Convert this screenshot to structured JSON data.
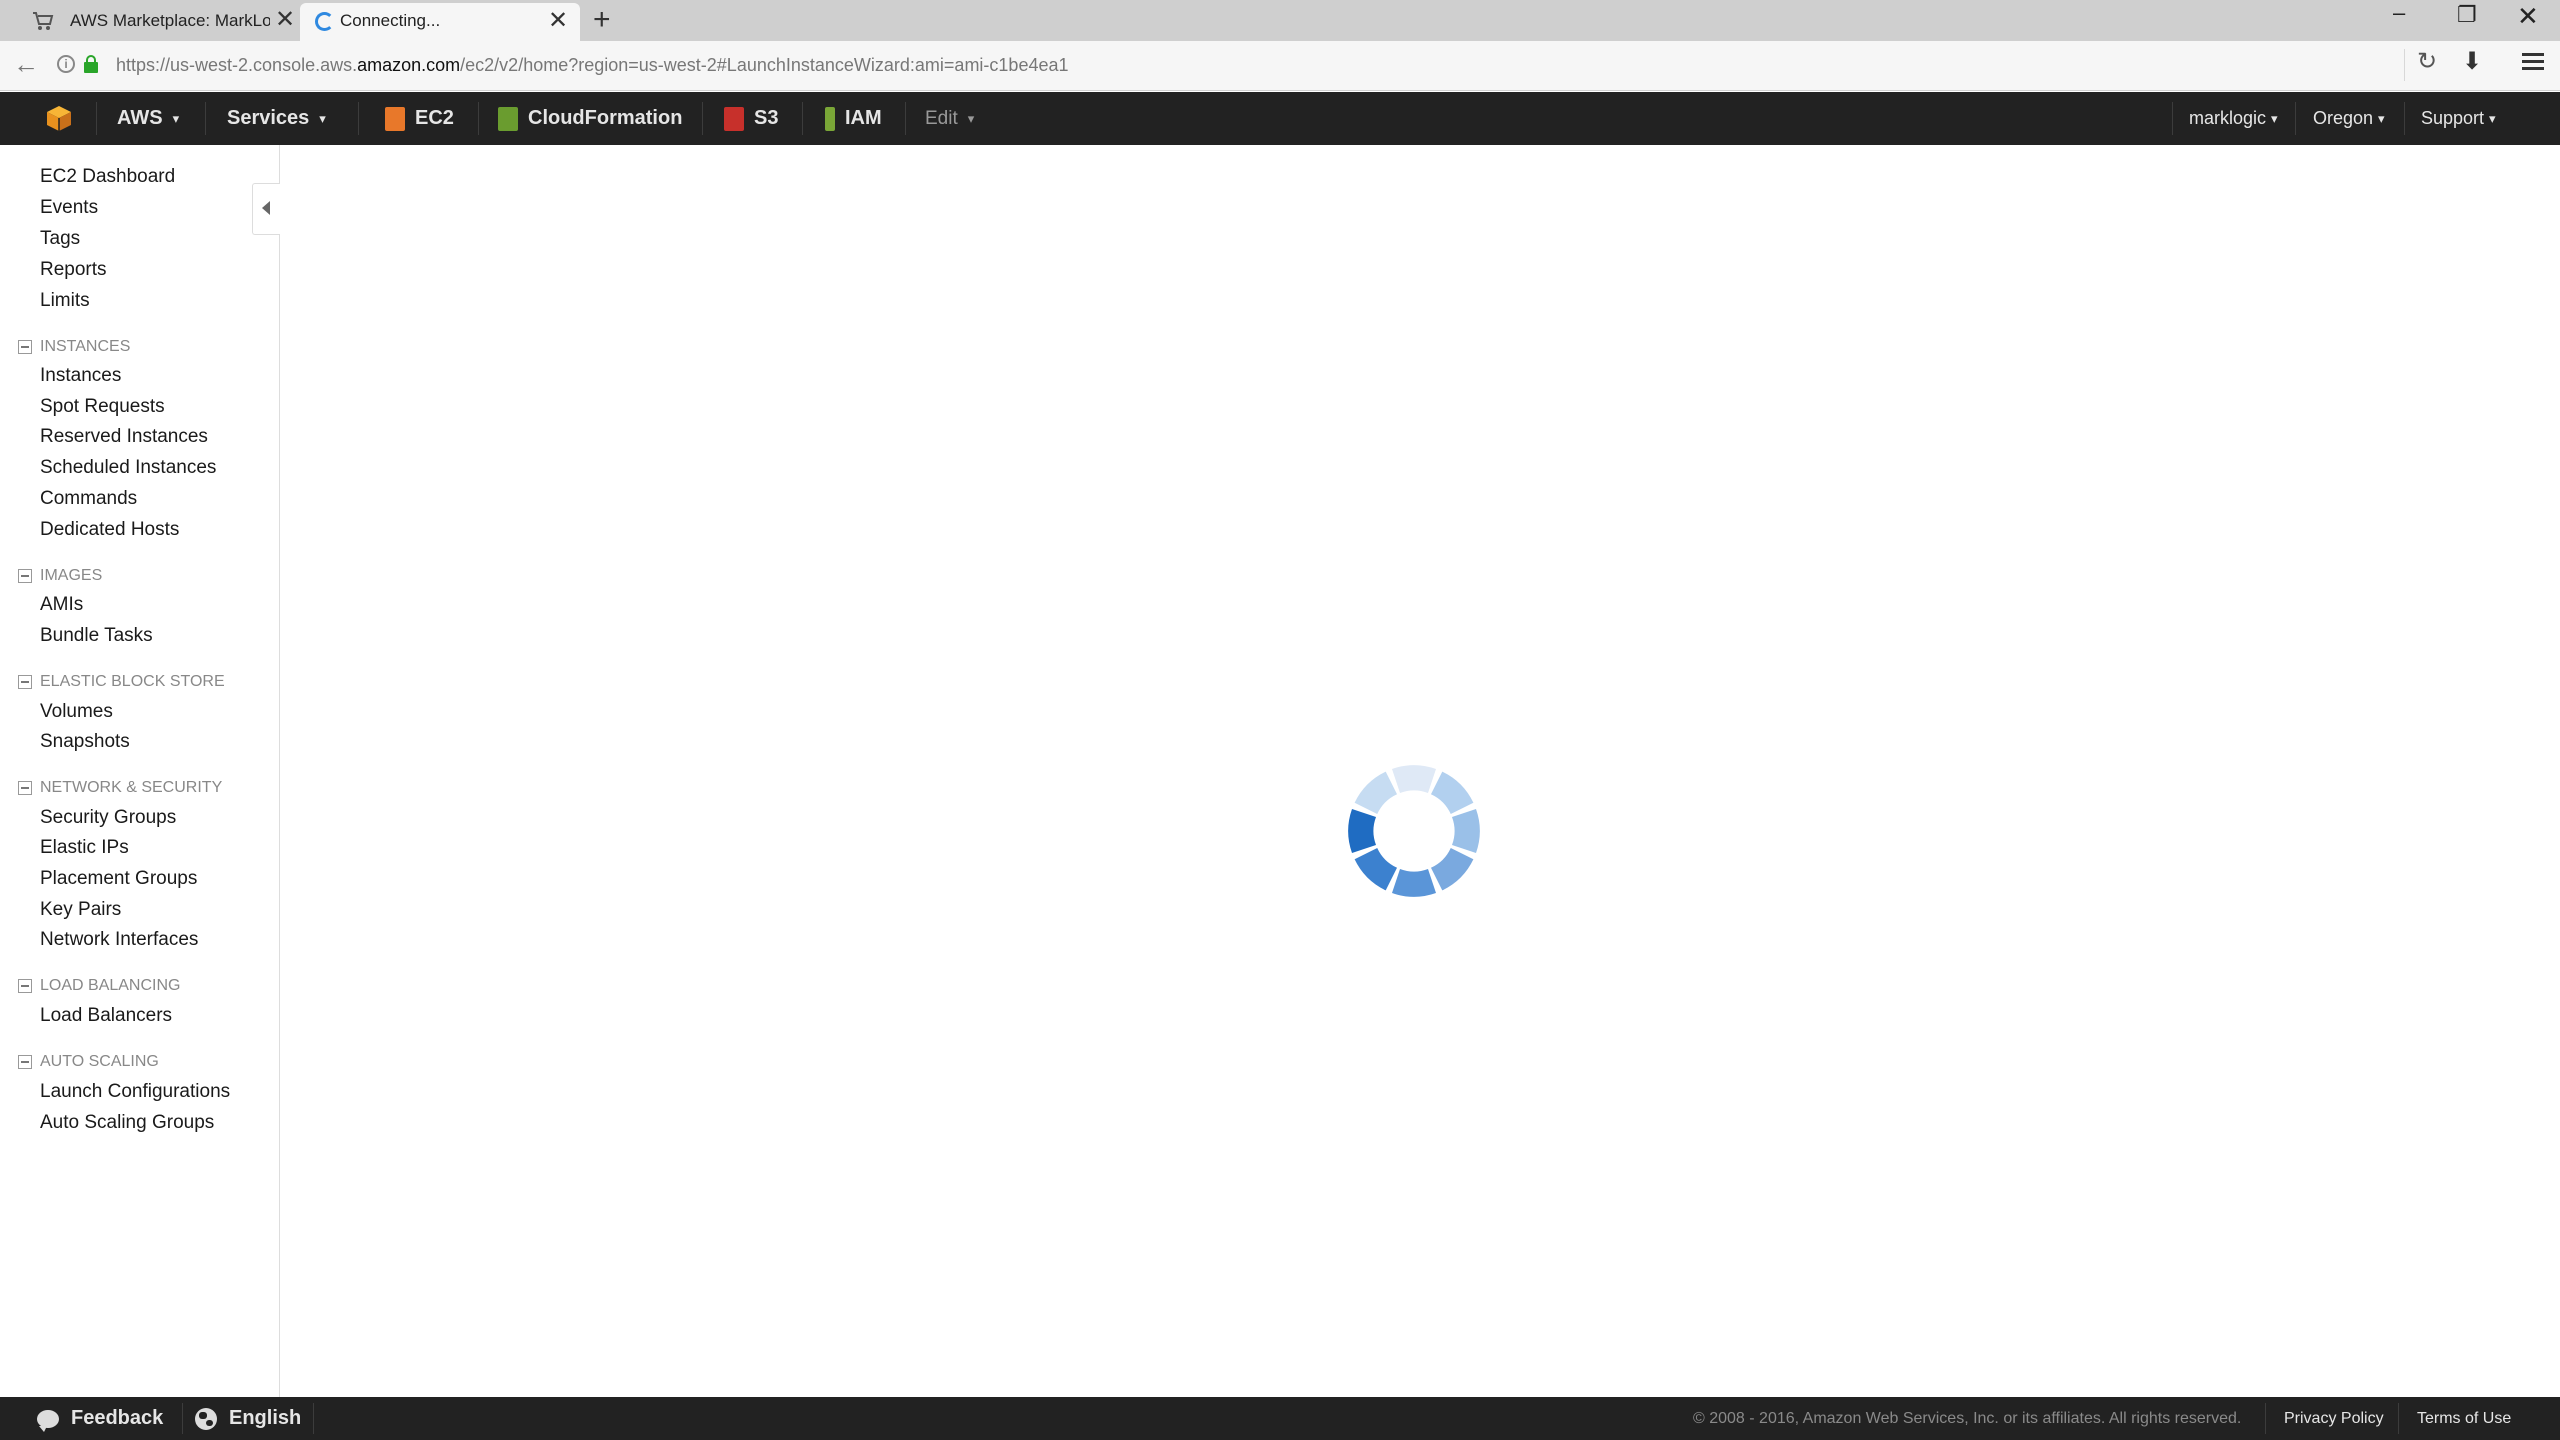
{
  "browser": {
    "tabs": [
      {
        "title": "AWS Marketplace: MarkLo...",
        "active": false
      },
      {
        "title": "Connecting...",
        "active": true
      }
    ],
    "url_prefix": "https://us-west-2.console.aws.",
    "url_host": "amazon.com",
    "url_suffix": "/ec2/v2/home?region=us-west-2#LaunchInstanceWizard:ami=ami-c1be4ea1",
    "back_icon": "←",
    "info_icon": "i",
    "reload_icon": "↻",
    "download_icon": "⬇",
    "newtab_icon": "+",
    "tab_close_icon": "✕",
    "window_min_icon": "–",
    "window_max_icon": "❐",
    "window_close_icon": "✕"
  },
  "nav": {
    "aws_label": "AWS",
    "services_label": "Services",
    "shortcuts": [
      {
        "label": "EC2",
        "color": "#e8782a"
      },
      {
        "label": "CloudFormation",
        "color": "#6a9c2f"
      },
      {
        "label": "S3",
        "color": "#c7302b"
      },
      {
        "label": "IAM",
        "color": "#7aa637"
      }
    ],
    "edit_label": "Edit",
    "account_label": "marklogic",
    "region_label": "Oregon",
    "support_label": "Support",
    "caret": "▾",
    "small_caret": "▾"
  },
  "sidebar": {
    "top_links": [
      "EC2 Dashboard",
      "Events",
      "Tags",
      "Reports",
      "Limits"
    ],
    "sections": [
      {
        "title": "INSTANCES",
        "items": [
          "Instances",
          "Spot Requests",
          "Reserved Instances",
          "Scheduled Instances",
          "Commands",
          "Dedicated Hosts"
        ]
      },
      {
        "title": "IMAGES",
        "items": [
          "AMIs",
          "Bundle Tasks"
        ]
      },
      {
        "title": "ELASTIC BLOCK STORE",
        "items": [
          "Volumes",
          "Snapshots"
        ]
      },
      {
        "title": "NETWORK & SECURITY",
        "items": [
          "Security Groups",
          "Elastic IPs",
          "Placement Groups",
          "Key Pairs",
          "Network Interfaces"
        ]
      },
      {
        "title": "LOAD BALANCING",
        "items": [
          "Load Balancers"
        ]
      },
      {
        "title": "AUTO SCALING",
        "items": [
          "Launch Configurations",
          "Auto Scaling Groups"
        ]
      }
    ]
  },
  "main": {
    "state": "loading",
    "spinner_colors": [
      "#1f6cc2",
      "#3c81cf",
      "#5a95d8",
      "#7aa9df",
      "#9ac0e8",
      "#b2d0ef"
    ]
  },
  "footer": {
    "feedback_label": "Feedback",
    "language_label": "English",
    "copyright": "© 2008 - 2016, Amazon Web Services, Inc. or its affiliates. All rights reserved.",
    "privacy_label": "Privacy Policy",
    "terms_label": "Terms of Use"
  }
}
